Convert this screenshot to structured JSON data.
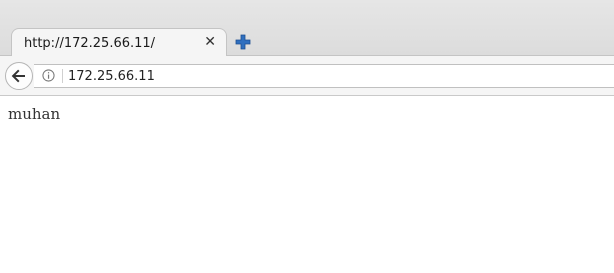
{
  "tab": {
    "title": "http://172.25.66.11/",
    "close_glyph": "✕"
  },
  "navbar": {
    "url": "172.25.66.11"
  },
  "page": {
    "body_text": "muhan"
  },
  "icons": {
    "close": "close-icon",
    "new_tab": "plus-icon",
    "back": "back-arrow-icon",
    "info": "info-icon"
  },
  "colors": {
    "new_tab_plus": "#2f6fbf"
  }
}
